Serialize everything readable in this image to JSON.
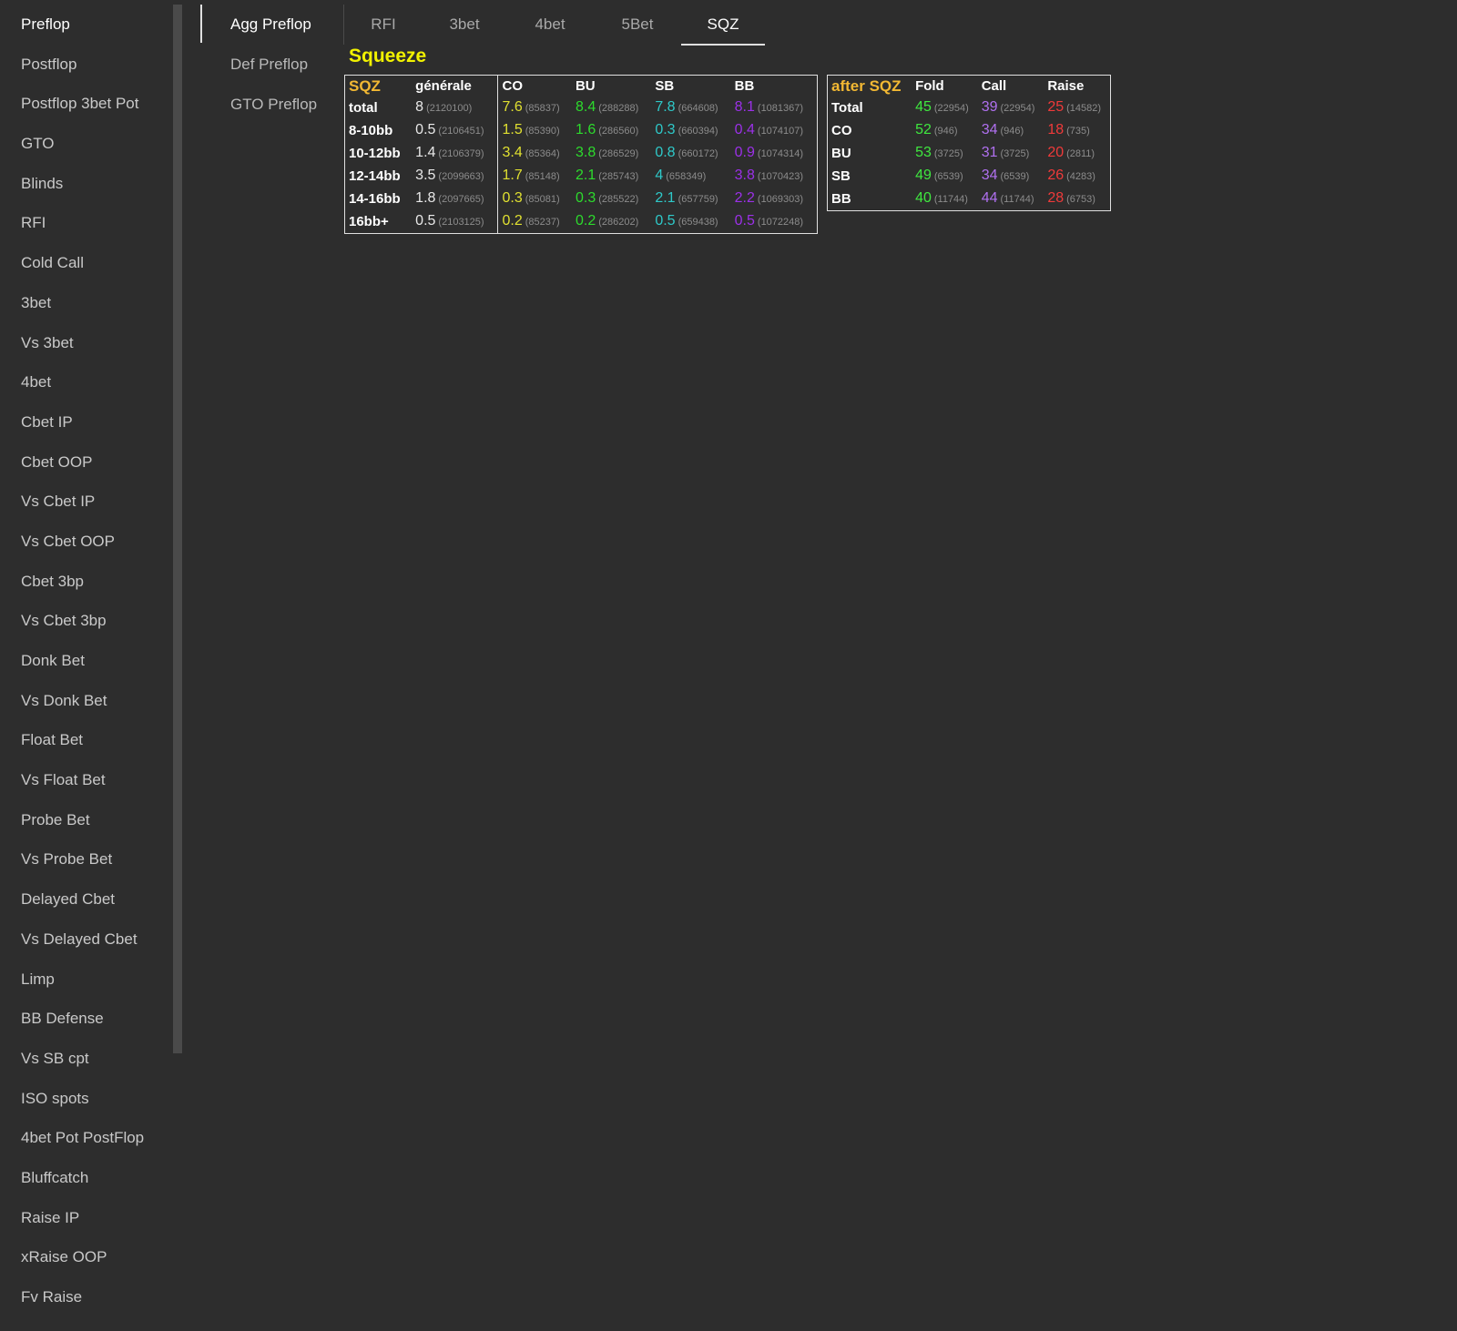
{
  "sidebar": {
    "items": [
      "Preflop",
      "Postflop",
      "Postflop 3bet Pot",
      "GTO",
      "Blinds",
      "RFI",
      "Cold Call",
      "3bet",
      "Vs 3bet",
      "4bet",
      "Cbet IP",
      "Cbet OOP",
      "Vs Cbet IP",
      "Vs Cbet OOP",
      "Cbet 3bp",
      "Vs Cbet 3bp",
      "Donk Bet",
      "Vs Donk Bet",
      "Float Bet",
      "Vs Float Bet",
      "Probe Bet",
      "Vs Probe Bet",
      "Delayed Cbet",
      "Vs Delayed Cbet",
      "Limp",
      "BB Defense",
      "Vs SB cpt",
      "ISO spots",
      "4bet Pot PostFlop",
      "Bluffcatch",
      "Raise IP",
      "xRaise OOP",
      "Fv Raise"
    ],
    "active": "Preflop"
  },
  "subnav": {
    "items": [
      "Agg Preflop",
      "Def Preflop",
      "GTO Preflop"
    ],
    "active": "Agg Preflop"
  },
  "tabs": {
    "items": [
      "RFI",
      "3bet",
      "4bet",
      "5Bet",
      "SQZ"
    ],
    "active": "SQZ"
  },
  "section_title": "Squeeze",
  "sqz_table": {
    "corner": "SQZ",
    "headers": [
      "générale",
      "CO",
      "BU",
      "SB",
      "BB"
    ],
    "rows": [
      {
        "label": "total",
        "cells": [
          [
            "8",
            "2120100"
          ],
          [
            "7.6",
            "85837"
          ],
          [
            "8.4",
            "288288"
          ],
          [
            "7.8",
            "664608"
          ],
          [
            "8.1",
            "1081367"
          ]
        ]
      },
      {
        "label": "8-10bb",
        "cells": [
          [
            "0.5",
            "2106451"
          ],
          [
            "1.5",
            "85390"
          ],
          [
            "1.6",
            "286560"
          ],
          [
            "0.3",
            "660394"
          ],
          [
            "0.4",
            "1074107"
          ]
        ]
      },
      {
        "label": "10-12bb",
        "cells": [
          [
            "1.4",
            "2106379"
          ],
          [
            "3.4",
            "85364"
          ],
          [
            "3.8",
            "286529"
          ],
          [
            "0.8",
            "660172"
          ],
          [
            "0.9",
            "1074314"
          ]
        ]
      },
      {
        "label": "12-14bb",
        "cells": [
          [
            "3.5",
            "2099663"
          ],
          [
            "1.7",
            "85148"
          ],
          [
            "2.1",
            "285743"
          ],
          [
            "4",
            "658349"
          ],
          [
            "3.8",
            "1070423"
          ]
        ]
      },
      {
        "label": "14-16bb",
        "cells": [
          [
            "1.8",
            "2097665"
          ],
          [
            "0.3",
            "85081"
          ],
          [
            "0.3",
            "285522"
          ],
          [
            "2.1",
            "657759"
          ],
          [
            "2.2",
            "1069303"
          ]
        ]
      },
      {
        "label": "16bb+",
        "cells": [
          [
            "0.5",
            "2103125"
          ],
          [
            "0.2",
            "85237"
          ],
          [
            "0.2",
            "286202"
          ],
          [
            "0.5",
            "659438"
          ],
          [
            "0.5",
            "1072248"
          ]
        ]
      }
    ]
  },
  "after_table": {
    "corner": "after SQZ",
    "headers": [
      "Fold",
      "Call",
      "Raise"
    ],
    "rows": [
      {
        "label": "Total",
        "cells": [
          [
            "45",
            "22954"
          ],
          [
            "39",
            "22954"
          ],
          [
            "25",
            "14582"
          ]
        ]
      },
      {
        "label": "CO",
        "cells": [
          [
            "52",
            "946"
          ],
          [
            "34",
            "946"
          ],
          [
            "18",
            "735"
          ]
        ]
      },
      {
        "label": "BU",
        "cells": [
          [
            "53",
            "3725"
          ],
          [
            "31",
            "3725"
          ],
          [
            "20",
            "2811"
          ]
        ]
      },
      {
        "label": "SB",
        "cells": [
          [
            "49",
            "6539"
          ],
          [
            "34",
            "6539"
          ],
          [
            "26",
            "4283"
          ]
        ]
      },
      {
        "label": "BB",
        "cells": [
          [
            "40",
            "11744"
          ],
          [
            "44",
            "11744"
          ],
          [
            "28",
            "6753"
          ]
        ]
      }
    ]
  },
  "colors": {
    "background": "#2d2d2d",
    "title": "#f2f200",
    "corner_label": "#f2b833",
    "general": "#e8e8e8",
    "co": "#e0e030",
    "bu": "#2ddb2d",
    "sb": "#2ec9c9",
    "bb": "#9b30e8",
    "fold": "#3fe83f",
    "call": "#b070f0",
    "raise": "#f03a3a"
  }
}
